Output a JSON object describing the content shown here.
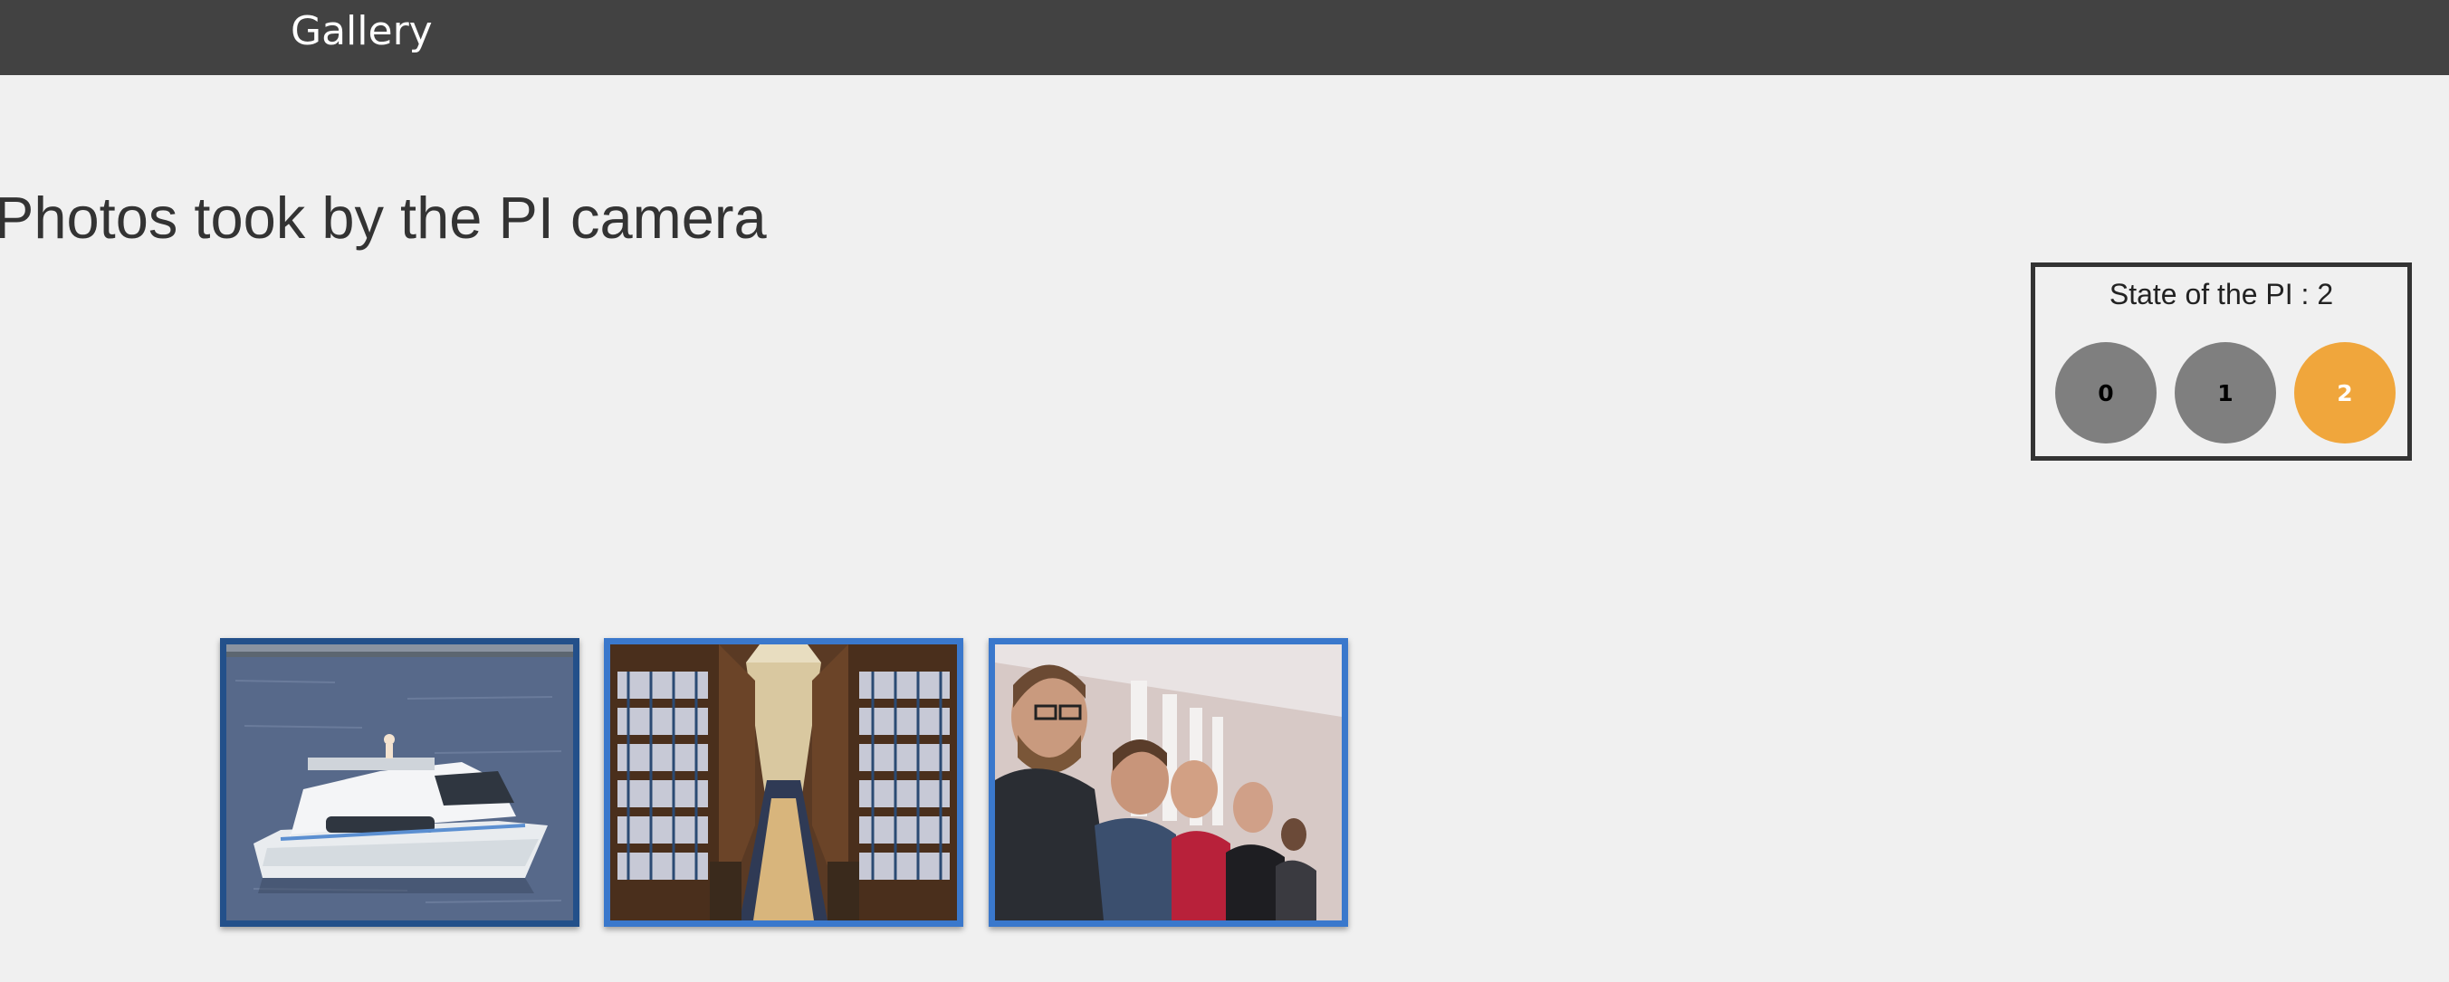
{
  "navbar": {
    "brand": "Gallery"
  },
  "main": {
    "title": "Photos took by the PI camera"
  },
  "pi_state": {
    "label": "State of the PI : 2",
    "current": 2,
    "states": [
      "0",
      "1",
      "2"
    ],
    "inactive_color": "#7f7f7f",
    "active_color": "#f0a63c"
  },
  "gallery": {
    "photos": [
      {
        "subject": "boat on water"
      },
      {
        "subject": "library aisle"
      },
      {
        "subject": "group selfie"
      }
    ],
    "border_color": "#3a78cc"
  }
}
